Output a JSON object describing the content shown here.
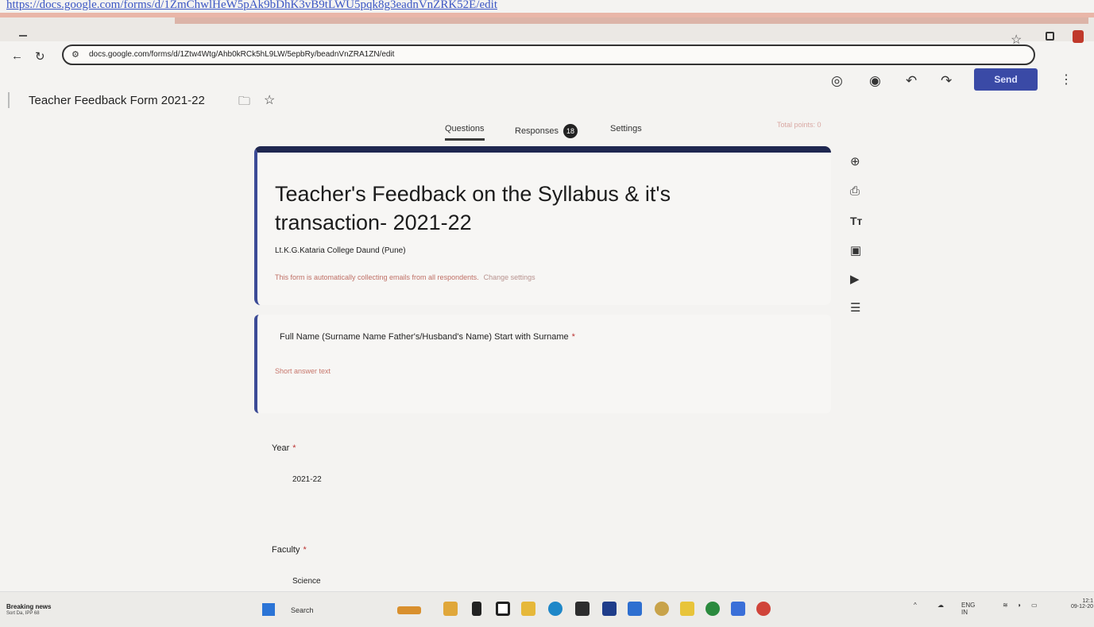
{
  "browser": {
    "top_link": "https://docs.google.com/forms/d/1ZmChwlHeW5pAk9bDhK3vB9tLWU5pqk8g3eadnVnZRK52E/edit",
    "address_url": "docs.google.com/forms/d/1Ztw4Wtg/Ahb0kRCk5hL9LW/5epbRy/beadnVnZRA1ZN/edit",
    "icons": [
      "minimize-icon",
      "star-icon",
      "extensions-icon",
      "profile-icon",
      "back-arrow-icon",
      "reload-icon",
      "site-info-icon"
    ]
  },
  "forms_header": {
    "doc_title": "Teacher Feedback Form 2021-22",
    "send_label": "Send",
    "icons": [
      "palette-icon",
      "preview-eye-icon",
      "undo-icon",
      "redo-icon",
      "more-vert-icon",
      "folder-icon",
      "star-icon"
    ]
  },
  "tabs": {
    "questions": "Questions",
    "responses": "Responses",
    "responses_count": "18",
    "settings": "Settings",
    "total_points": "Total points: 0"
  },
  "form": {
    "title": "Teacher's Feedback on the Syllabus & it's transaction-  2021-22",
    "subtitle": "Lt.K.G.Kataria College Daund (Pune)",
    "email_note": "This form is automatically collecting emails from all respondents.",
    "change_settings": "Change settings"
  },
  "questions": [
    {
      "label": "Full Name (Surname Name Father's/Husband's Name) Start with Surname",
      "required": "*",
      "placeholder": "Short answer text"
    },
    {
      "label": "Year",
      "required": "*",
      "value": "2021-22"
    },
    {
      "label": "Faculty",
      "required": "*",
      "value": "Science"
    }
  ],
  "side_toolbar": [
    "add-question-icon",
    "import-questions-icon",
    "add-title-icon",
    "add-image-icon",
    "add-video-icon",
    "add-section-icon"
  ],
  "taskbar": {
    "news_title": "Breaking news",
    "news_sub": "Sort Da, IPP 68",
    "search_label": "Search",
    "lang": "ENG",
    "region": "IN",
    "time": "12:1",
    "date": "09-12-20"
  }
}
